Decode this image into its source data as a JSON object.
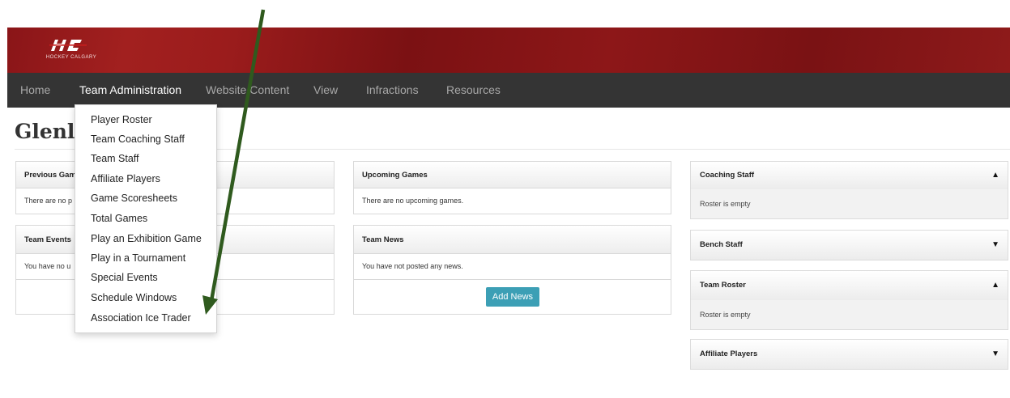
{
  "header": {
    "logo_text": "HOCKEY CALGARY",
    "brand_color": "#8e1718"
  },
  "nav": {
    "items": [
      "Home",
      "Team Administration",
      "Website Content",
      "View",
      "Infractions",
      "Resources"
    ],
    "active": "Team Administration"
  },
  "page": {
    "title": "Glenla"
  },
  "panels": {
    "previous_games": {
      "title": "Previous Gam",
      "body": "There are no p"
    },
    "team_events": {
      "title": "Team Events",
      "body": "You have no u"
    },
    "upcoming_games": {
      "title": "Upcoming Games",
      "body": "There are no upcoming games."
    },
    "team_news": {
      "title": "Team News",
      "body": "You have not posted any news.",
      "button": "Add News"
    }
  },
  "right": {
    "coaching_staff": {
      "title": "Coaching Staff",
      "body": "Roster is empty",
      "toggle": "▲"
    },
    "bench_staff": {
      "title": "Bench Staff",
      "toggle": "▼"
    },
    "team_roster": {
      "title": "Team Roster",
      "body": "Roster is empty",
      "toggle": "▲"
    },
    "affiliate_players": {
      "title": "Affiliate Players",
      "toggle": "▼"
    }
  },
  "dropdown": {
    "items": [
      "Player Roster",
      "Team Coaching Staff",
      "Team Staff",
      "Affiliate Players",
      "Game Scoresheets",
      "Total Games",
      "Play an Exhibition Game",
      "Play in a Tournament",
      "Special Events",
      "Schedule Windows",
      "Association Ice Trader"
    ]
  },
  "annotation": {
    "arrow_color": "#2f5a1e"
  }
}
